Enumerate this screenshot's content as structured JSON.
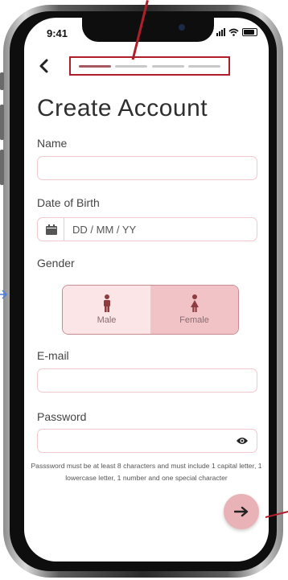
{
  "status": {
    "time": "9:41"
  },
  "nav": {
    "back_icon": "chevron-left-icon",
    "steps_total": 4,
    "steps_active": 1
  },
  "title": "Create Account",
  "form": {
    "name_label": "Name",
    "name_value": "",
    "dob_label": "Date of Birth",
    "dob_placeholder": "DD / MM / YY",
    "gender_label": "Gender",
    "gender_options": [
      "Male",
      "Female"
    ],
    "gender_selected": "Female",
    "email_label": "E-mail",
    "email_value": "",
    "password_label": "Password",
    "password_value": "",
    "password_hint": "Passsword must be at least 8 characters and must include 1 capital letter, 1 lowercase letter, 1 number and one special character"
  },
  "colors": {
    "accent": "#e8b2b6",
    "field_border": "#f1c8cd",
    "annotation": "#b11e2b"
  }
}
